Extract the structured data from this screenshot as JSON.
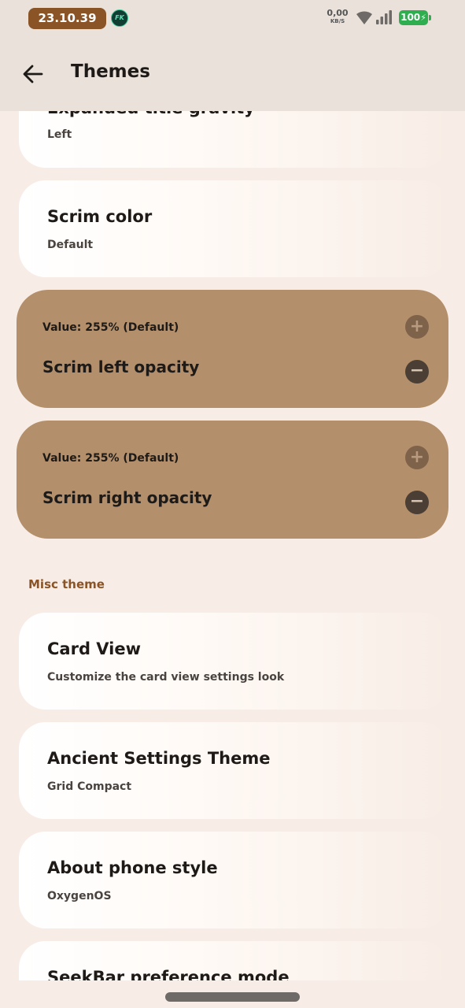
{
  "status_bar": {
    "time": "23.10.39",
    "badge": "FK",
    "net_speed_value": "0,00",
    "net_speed_unit": "KB/S",
    "battery": "100"
  },
  "app_bar": {
    "title": "Themes"
  },
  "cards": [
    {
      "title": "Expanded title gravity",
      "subtitle": "Left"
    },
    {
      "title": "Scrim color",
      "subtitle": "Default"
    }
  ],
  "sliders": [
    {
      "value_text": "Value: 255% (Default)",
      "label": "Scrim left opacity"
    },
    {
      "value_text": "Value: 255% (Default)",
      "label": "Scrim right opacity"
    }
  ],
  "section": {
    "title": "Misc theme"
  },
  "misc_cards": [
    {
      "title": "Card View",
      "subtitle": "Customize the card view settings look"
    },
    {
      "title": "Ancient Settings Theme",
      "subtitle": "Grid Compact"
    },
    {
      "title": "About phone style",
      "subtitle": "OxygenOS"
    },
    {
      "title": "SeekBar preference mode",
      "subtitle": ""
    }
  ],
  "colors": {
    "accent": "#8a5426",
    "slider_card": "#b48f6b",
    "background": "#f8ede6",
    "appbar": "#e9e1da",
    "battery": "#2fae4f"
  },
  "icons": [
    "back-arrow-icon",
    "wifi-icon",
    "signal-icon",
    "battery-icon",
    "plus-icon",
    "minus-icon"
  ]
}
